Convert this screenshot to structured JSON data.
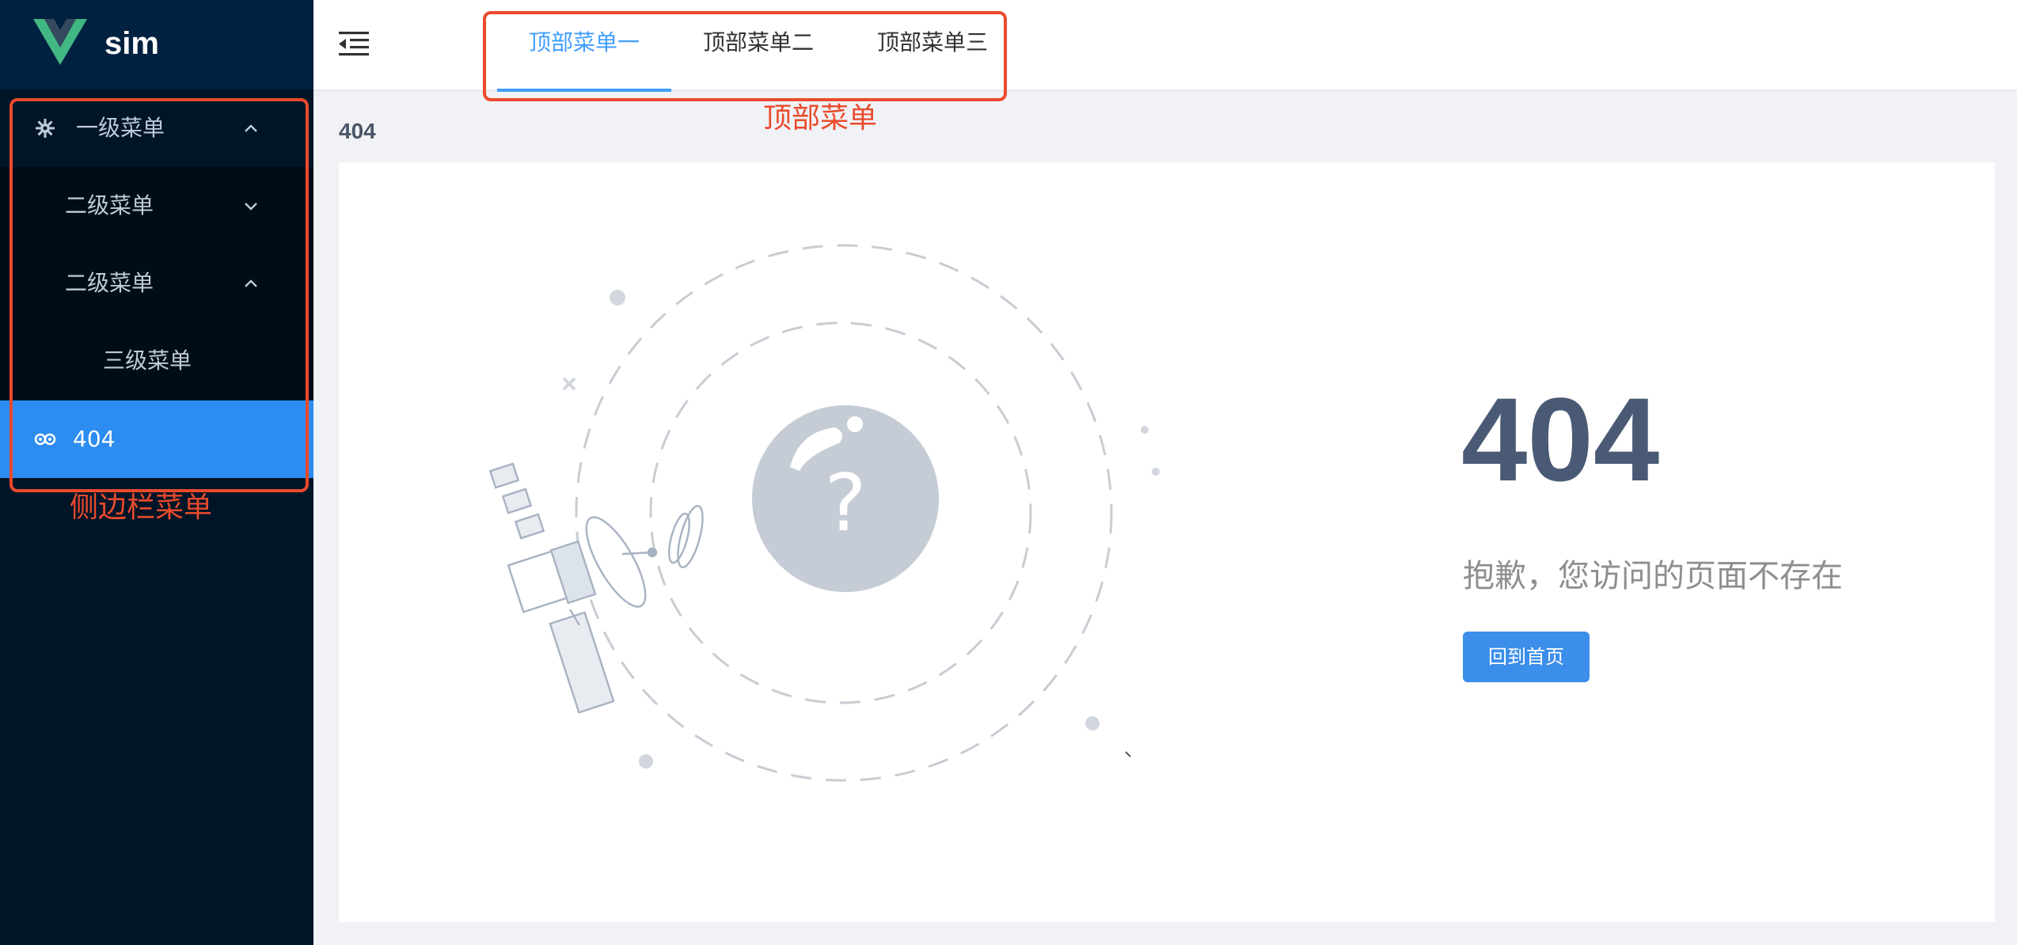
{
  "app": {
    "name": "sim"
  },
  "sidebar": {
    "menu_level1": "一级菜单",
    "menu_level2_a": "二级菜单",
    "menu_level2_b": "二级菜单",
    "menu_level3": "三级菜单",
    "menu_404": "404"
  },
  "header": {
    "tabs": [
      {
        "label": "顶部菜单一",
        "active": true
      },
      {
        "label": "顶部菜单二",
        "active": false
      },
      {
        "label": "顶部菜单三",
        "active": false
      }
    ]
  },
  "annotations": {
    "top_menu": "顶部菜单",
    "sidebar_menu": "侧边栏菜单"
  },
  "breadcrumb": "404",
  "error": {
    "code": "404",
    "message": "抱歉，您访问的页面不存在",
    "back_home_label": "回到首页"
  },
  "colors": {
    "sidebar_bg": "#001528",
    "active_item": "#2d8cf0",
    "accent": "#409eff",
    "annotation": "#ea4a2c"
  },
  "icons": [
    "vue-logo-icon",
    "gear-icon",
    "chevron-up-icon",
    "chevron-down-icon",
    "link-icon",
    "hamburger-fold-icon",
    "satellite-illustration"
  ]
}
